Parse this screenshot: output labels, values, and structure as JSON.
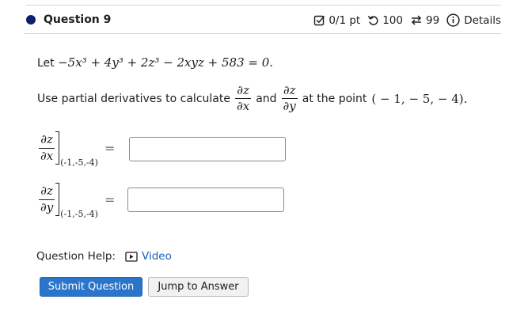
{
  "question": {
    "title": "Question 9",
    "score": "0/1 pt",
    "tries": "100",
    "submissions": "99",
    "details_label": "Details"
  },
  "prompt": {
    "let_word": "Let",
    "equation": "−5x³ + 4y³ + 2z³ − 2xyz + 583 = 0.",
    "use_text": "Use partial derivatives to calculate",
    "and_text": "and",
    "at_point_text": "at the point",
    "point": "( − 1,  − 5,  − 4)."
  },
  "fractions": {
    "dz": "∂z",
    "dx": "∂x",
    "dy": "∂y"
  },
  "answers": {
    "eval_point": "(-1,-5,-4)",
    "equals": "=",
    "dzdx_value": "",
    "dzdy_value": ""
  },
  "help": {
    "label": "Question Help:",
    "video_label": "Video"
  },
  "buttons": {
    "submit": "Submit Question",
    "jump": "Jump to Answer"
  },
  "colors": {
    "accent": "#2a74c9",
    "link": "#1b5fb5",
    "dot": "#0f1f6e"
  }
}
